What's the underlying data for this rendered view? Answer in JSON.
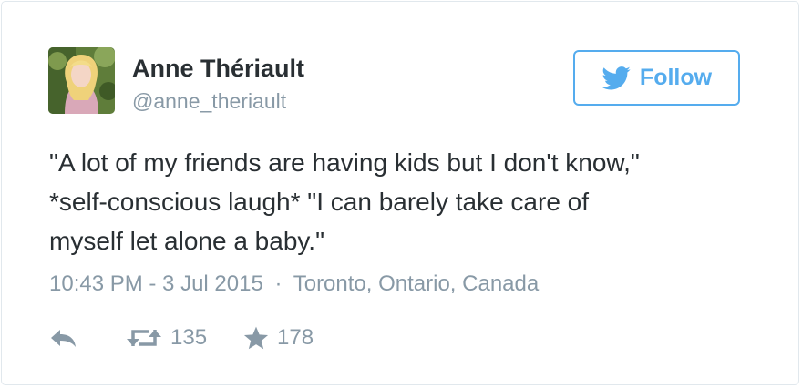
{
  "tweet": {
    "author": {
      "display_name": "Anne Thériault",
      "handle": "@anne_theriault"
    },
    "follow_button": {
      "label": "Follow",
      "icon": "twitter-bird-icon"
    },
    "text_lines": [
      "\"A lot of my friends are having kids but I don't know,\"",
      "*self-conscious laugh* \"I can barely take care of",
      "myself let alone a baby.\""
    ],
    "timestamp": "10:43 PM - 3 Jul 2015",
    "separator": "·",
    "location": "Toronto, Ontario, Canada",
    "actions": {
      "reply_icon": "reply-icon",
      "retweet_icon": "retweet-icon",
      "retweet_count": "135",
      "favorite_icon": "star-icon",
      "favorite_count": "178"
    }
  },
  "colors": {
    "accent": "#55acee",
    "text": "#292f33",
    "muted": "#8899a6",
    "border": "#e1e8ed"
  }
}
